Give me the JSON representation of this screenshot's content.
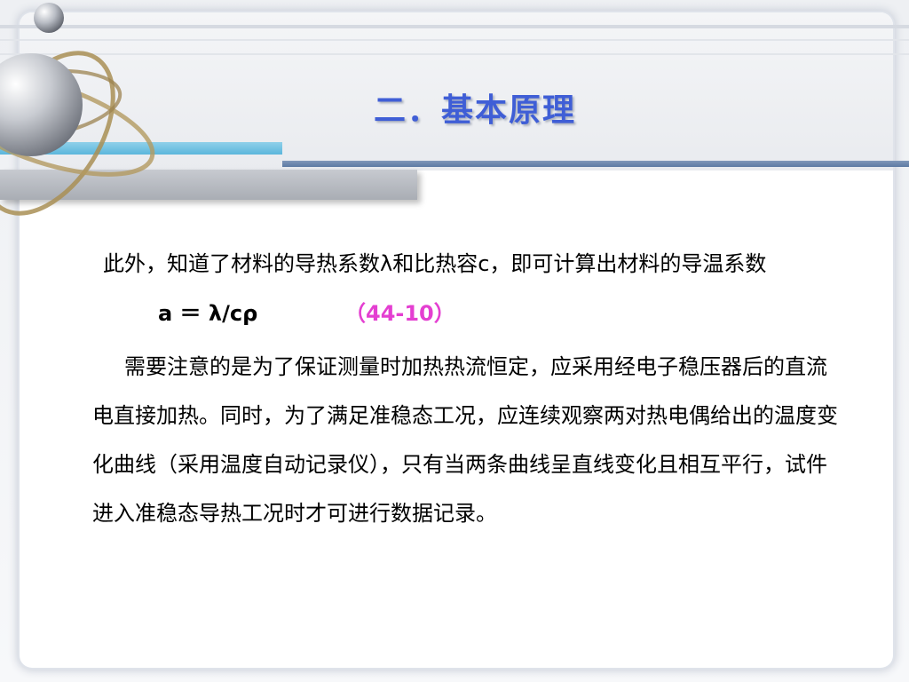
{
  "slide": {
    "title": "二．基本原理",
    "paragraph_1": "此外，知道了材料的导热系数λ和比热容c，即可计算出材料的导温系数",
    "formula": {
      "expression": "a ＝ λ/cρ",
      "number": "（44-10）"
    },
    "paragraph_2": "需要注意的是为了保证测量时加热热流恒定，应采用经电子稳压器后的直流电直接加热。同时，为了满足准稳态工况，应连续观察两对热电偶给出的温度变化曲线（采用温度自动记录仪），只有当两条曲线呈直线变化且相互平行，试件进入准稳态导热工况时才可进行数据记录。"
  },
  "colors": {
    "title": "#3f5ed6",
    "equation_number": "#e43fd1",
    "accent_blue_bar": "#5bb6dc",
    "accent_navy_line": "#5d7aa3"
  },
  "icons": {
    "decoration": "atom-orbit-icon"
  }
}
